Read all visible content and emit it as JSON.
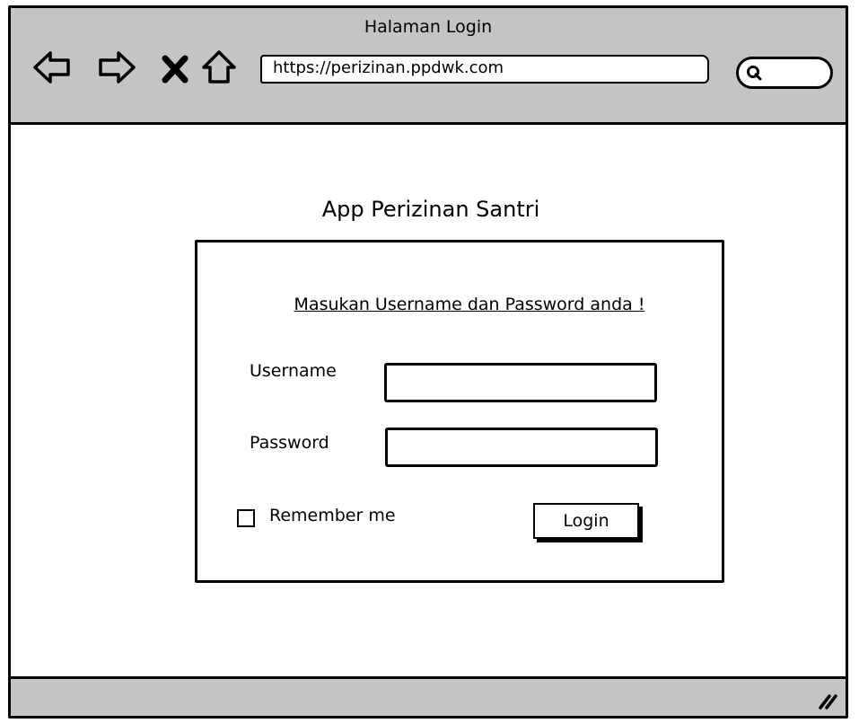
{
  "window": {
    "title": "Halaman Login",
    "url": "https://perizinan.ppdwk.com"
  },
  "icons": {
    "back": "back-arrow-icon",
    "forward": "forward-arrow-icon",
    "stop": "close-icon",
    "home": "home-icon",
    "search": "search-icon",
    "resize": "resize-grip-icon"
  },
  "main": {
    "app_title": "App Perizinan Santri",
    "instruction": "Masukan Username dan Password anda !",
    "username_label": "Username",
    "username_value": "",
    "password_label": "Password",
    "password_value": "",
    "remember_label": "Remember me",
    "remember_checked": false,
    "login_button": "Login"
  },
  "colors": {
    "chrome": "#c4c4c4",
    "ink": "#000000",
    "background": "#ffffff"
  }
}
